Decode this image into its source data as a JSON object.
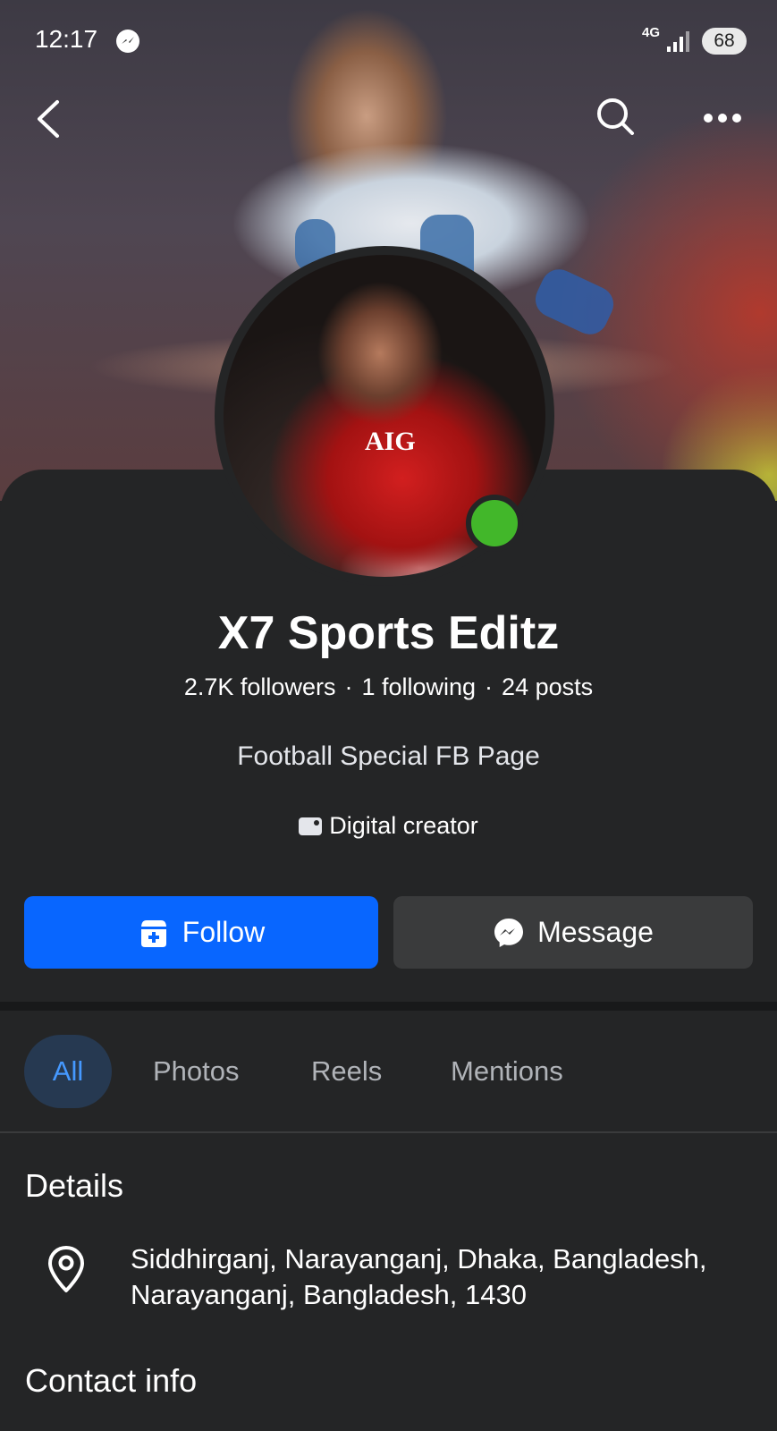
{
  "status_bar": {
    "time": "12:17",
    "network": "4G",
    "battery": "68"
  },
  "header": {
    "back_icon": "chevron-left-icon",
    "search_icon": "search-icon",
    "more_icon": "more-dots-icon"
  },
  "profile": {
    "name": "X7 Sports Editz",
    "followers": "2.7K followers",
    "following": "1 following",
    "posts": "24 posts",
    "separator": "·",
    "bio": "Football Special FB Page",
    "category": "Digital creator",
    "online": true,
    "sponsor_text": "AIG"
  },
  "actions": {
    "follow_label": "Follow",
    "message_label": "Message"
  },
  "tabs": [
    {
      "label": "All",
      "active": true
    },
    {
      "label": "Photos",
      "active": false
    },
    {
      "label": "Reels",
      "active": false
    },
    {
      "label": "Mentions",
      "active": false
    }
  ],
  "details": {
    "title": "Details",
    "address_line1": "Siddhirganj, Narayanganj, Dhaka, Bangladesh,",
    "address_line2": "Narayanganj, Bangladesh, 1430"
  },
  "contact": {
    "title": "Contact info"
  },
  "colors": {
    "background": "#242526",
    "primary_button": "#0866ff",
    "secondary_button": "#3a3b3c",
    "active_tab_bg": "#263951",
    "active_tab_text": "#4599ff",
    "online_dot": "#42b72a"
  }
}
